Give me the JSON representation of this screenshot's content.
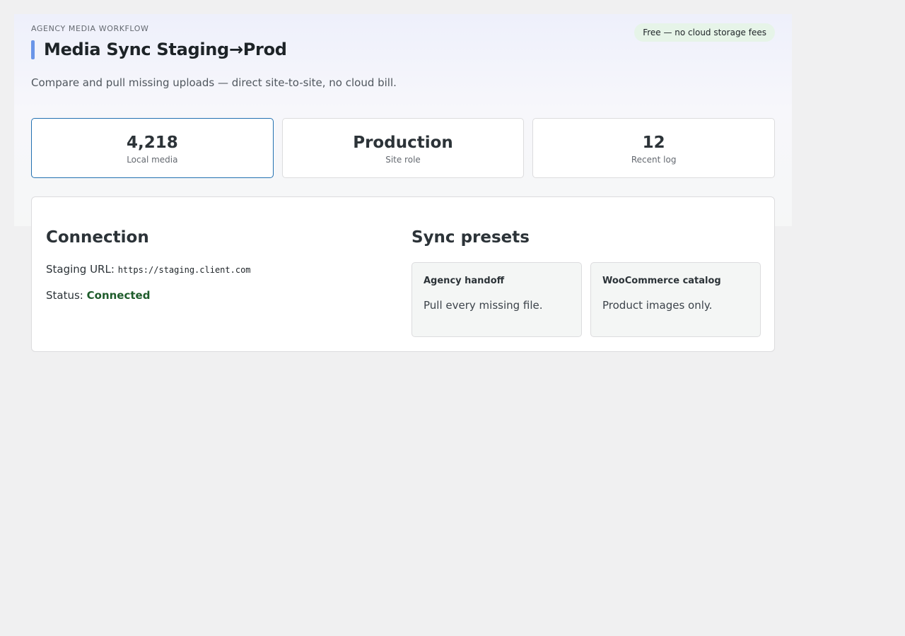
{
  "header": {
    "eyebrow": "AGENCY MEDIA WORKFLOW",
    "title": "Media Sync Staging→Prod",
    "badge": "Free — no cloud storage fees",
    "subtitle": "Compare and pull missing uploads — direct site-to-site, no cloud bill."
  },
  "stats": [
    {
      "value": "4,218",
      "label": "Local media"
    },
    {
      "value": "Production",
      "label": "Site role"
    },
    {
      "value": "12",
      "label": "Recent log"
    }
  ],
  "connection": {
    "heading": "Connection",
    "url_label": "Staging URL:",
    "url_value": "https://staging.client.com",
    "status_label": "Status:",
    "status_value": "Connected"
  },
  "presets": {
    "heading": "Sync presets",
    "items": [
      {
        "name": "Agency handoff",
        "description": "Pull every missing file."
      },
      {
        "name": "WooCommerce catalog",
        "description": "Product images only."
      }
    ]
  },
  "colors": {
    "accent": "#6a95e8",
    "active_border": "#2271b1",
    "badge_bg": "#e6f4e8",
    "connected": "#1e5c2b"
  }
}
